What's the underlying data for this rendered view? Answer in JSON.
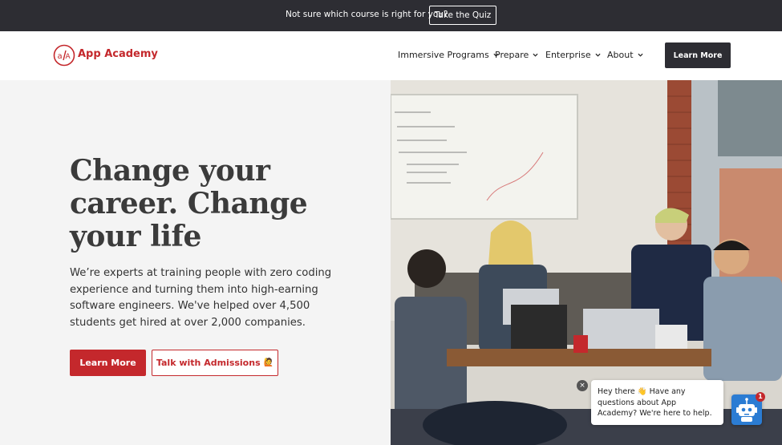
{
  "announcement": {
    "text": "Not sure which course is right for you?",
    "quiz_button": "Take the Quiz"
  },
  "nav": {
    "logo_text": "App Academy",
    "items": [
      {
        "label": "Immersive Programs"
      },
      {
        "label": "Prepare"
      },
      {
        "label": "Enterprise"
      },
      {
        "label": "About"
      }
    ],
    "cta": "Learn More"
  },
  "hero": {
    "headline": "Change your career. Change your life",
    "subtext": "We’re experts at training people with zero coding experience and turning them into high-earning software engineers. We've helped over 4,500 students get hired at over 2,000 companies.",
    "primary_button": "Learn More",
    "secondary_button": "Talk with Admissions",
    "secondary_button_emoji": "🙋"
  },
  "chat": {
    "message": "Hey there 👋 Have any questions about App Academy? We're here to help.",
    "badge_count": "1",
    "close_icon": "close-icon",
    "bot_icon": "robot-icon"
  },
  "colors": {
    "brand_red": "#c4282c",
    "dark": "#2d2d33",
    "hero_bg": "#f4f4f4",
    "chat_blue": "#2b7cd3"
  }
}
